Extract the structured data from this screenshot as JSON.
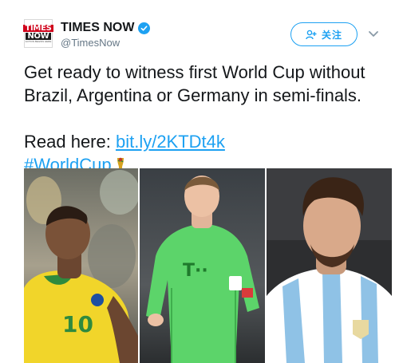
{
  "account": {
    "avatar_top": "TIMES",
    "avatar_bottom": "NOW",
    "avatar_tagline": "ACTION BEGINS HERE",
    "name": "TIMES NOW",
    "handle": "@TimesNow",
    "verified": true
  },
  "follow_button": {
    "label": "关注"
  },
  "menu": {
    "icon": "chevron-down-icon"
  },
  "tweet": {
    "line1": "Get ready to witness first World Cup without",
    "line2": "Brazil, Argentina or Germany in semi-finals.",
    "read_label": "Read here: ",
    "link": "bit.ly/2KTDt4k",
    "hashtag": "#WorldCup",
    "hashtag_icon": "world-cup-trophy-icon"
  },
  "media": {
    "jersey_brazil_number": "10",
    "jersey_germany_sponsor": "T··"
  },
  "colors": {
    "accent": "#1da1f2",
    "text": "#14171a",
    "muted": "#657786",
    "brazil_yellow": "#f1d52a",
    "keeper_green": "#5cd46a",
    "argentina_blue": "#8fc2e6"
  }
}
